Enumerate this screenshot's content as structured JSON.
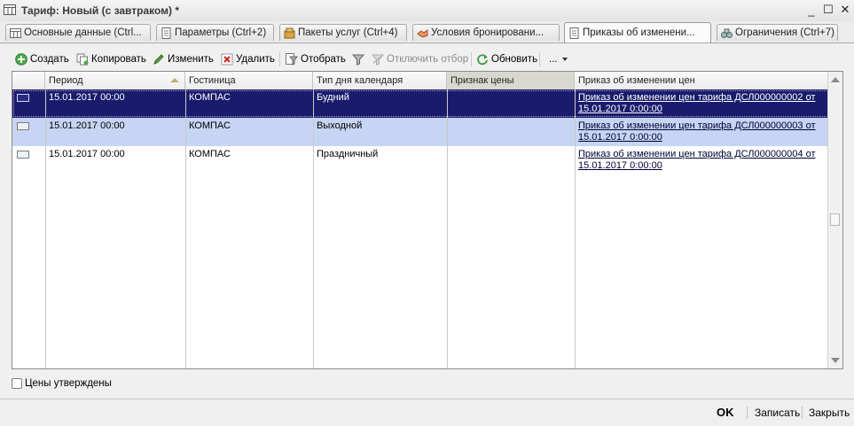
{
  "window": {
    "title": "Тариф: Новый (с завтраком) *",
    "minimize_glyph": "_",
    "maximize_glyph": "☐",
    "close_glyph": "✕"
  },
  "tabs": [
    {
      "label": "Основные данные (Ctrl...",
      "icon": "table-icon"
    },
    {
      "label": "Параметры (Ctrl+2)",
      "icon": "document-icon"
    },
    {
      "label": "Пакеты услуг (Ctrl+4)",
      "icon": "package-icon"
    },
    {
      "label": "Условия бронировани...",
      "icon": "handshake-icon"
    },
    {
      "label": "Приказы об изменени...",
      "icon": "document-icon",
      "active": true
    },
    {
      "label": "Ограничения (Ctrl+7)",
      "icon": "binoculars-icon"
    }
  ],
  "toolbar": {
    "create": "Создать",
    "copy": "Копировать",
    "edit": "Изменить",
    "delete": "Удалить",
    "filter": "Отобрать",
    "disable_filter": "Отключить отбор",
    "refresh": "Обновить",
    "more": "..."
  },
  "table": {
    "columns": [
      "Период",
      "Гостиница",
      "Тип дня календаря",
      "Признак цены",
      "Приказ об изменении цен"
    ],
    "rows": [
      {
        "period": "15.01.2017 00:00",
        "hotel": "КОМПАС",
        "day_type": "Будний",
        "price_flag": "",
        "order": "Приказ об изменении цен тарифа ДСЛ000000002 от 15.01.2017 0:00:00"
      },
      {
        "period": "15.01.2017 00:00",
        "hotel": "КОМПАС",
        "day_type": "Выходной",
        "price_flag": "",
        "order": "Приказ об изменении цен тарифа ДСЛ000000003 от 15.01.2017 0:00:00"
      },
      {
        "period": "15.01.2017 00:00",
        "hotel": "КОМПАС",
        "day_type": "Праздничный",
        "price_flag": "",
        "order": "Приказ об изменении цен тарифа ДСЛ000000004 от 15.01.2017 0:00:00"
      }
    ]
  },
  "checkbox": {
    "label": "Цены утверждены",
    "checked": false
  },
  "footer": {
    "ok": "OK",
    "save": "Записать",
    "close": "Закрыть"
  },
  "colors": {
    "selected_row": "#1b1b6e",
    "alt_row": "#c6d5f3",
    "accent_green": "#3c9a3c",
    "delete_red": "#cc2222"
  }
}
